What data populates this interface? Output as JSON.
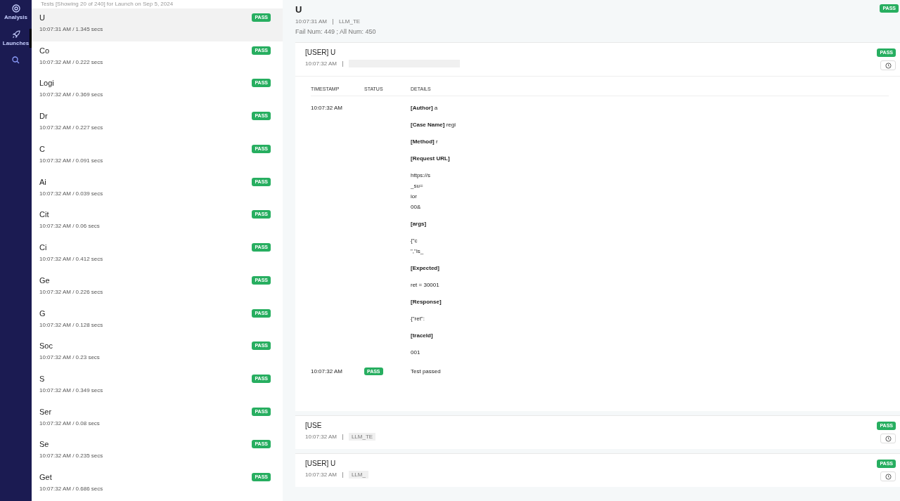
{
  "nav": [
    {
      "label": "Analysis",
      "selected": false
    },
    {
      "label": "Launches",
      "selected": true
    },
    {
      "selected": false
    }
  ],
  "list": {
    "header": "Tests [Showing 20 of 240] for Launch on Sep 5, 2024",
    "items": [
      {
        "name": "U",
        "meta": "10:07:31 AM / 1.345 secs",
        "status": "PASS",
        "selected": true
      },
      {
        "name": "Co",
        "meta": "10:07:32 AM / 0.222 secs",
        "status": "PASS",
        "selected": false
      },
      {
        "name": "Logi",
        "meta": "10:07:32 AM / 0.369 secs",
        "status": "PASS",
        "selected": false
      },
      {
        "name": "Dr",
        "meta": "10:07:32 AM / 0.227 secs",
        "status": "PASS",
        "selected": false
      },
      {
        "name": "C",
        "meta": "10:07:32 AM / 0.091 secs",
        "status": "PASS",
        "selected": false
      },
      {
        "name": "Ai",
        "meta": "10:07:32 AM / 0.039 secs",
        "status": "PASS",
        "selected": false
      },
      {
        "name": "Cit",
        "meta": "10:07:32 AM / 0.06 secs",
        "status": "PASS",
        "selected": false
      },
      {
        "name": "Ci",
        "meta": "10:07:32 AM / 0.412 secs",
        "status": "PASS",
        "selected": false
      },
      {
        "name": "Ge",
        "meta": "10:07:32 AM / 0.226 secs",
        "status": "PASS",
        "selected": false
      },
      {
        "name": "G",
        "meta": "10:07:32 AM / 0.128 secs",
        "status": "PASS",
        "selected": false
      },
      {
        "name": "Soc",
        "meta": "10:07:32 AM / 0.23 secs",
        "status": "PASS",
        "selected": false
      },
      {
        "name": "S",
        "meta": "10:07:32 AM / 0.349 secs",
        "status": "PASS",
        "selected": false
      },
      {
        "name": "Ser",
        "meta": "10:07:32 AM / 0.08 secs",
        "status": "PASS",
        "selected": false
      },
      {
        "name": "Se",
        "meta": "10:07:32 AM / 0.235 secs",
        "status": "PASS",
        "selected": false
      },
      {
        "name": "Get",
        "meta": "10:07:32 AM / 0.686 secs",
        "status": "PASS",
        "selected": false
      }
    ]
  },
  "detail": {
    "title": "U",
    "status": "PASS",
    "time": "10:07:31 AM",
    "id": "LLM_TE",
    "counts": "Fail Num: 449 ; All Num: 450",
    "tests": [
      {
        "title": "[USER] U",
        "time": "10:07:32 AM",
        "status": "PASS",
        "columns": [
          "TIMESTAMP",
          "STATUS",
          "DETAILS"
        ],
        "logs": [
          {
            "time": "10:07:32 AM",
            "lines": [
              {
                "kind": "field",
                "label": "[Author]",
                "text": "a"
              },
              {
                "kind": "field",
                "label": "[Case Name]",
                "text": "regi"
              },
              {
                "kind": "field",
                "label": "[Method]",
                "text": "r"
              },
              {
                "kind": "label",
                "text": "[Request URL]"
              },
              {
                "kind": "text",
                "text": "https://s"
              },
              {
                "kind": "text",
                "text": "_su="
              },
              {
                "kind": "text",
                "text": "ior"
              },
              {
                "kind": "text",
                "text": "00&"
              },
              {
                "kind": "label",
                "text": "[args]"
              },
              {
                "kind": "text",
                "text": "{\"c"
              },
              {
                "kind": "text",
                "text": "\",\"is_"
              },
              {
                "kind": "label",
                "text": "[Expected]"
              },
              {
                "kind": "text",
                "text": "ret = 30001"
              },
              {
                "kind": "label",
                "text": "[Response]"
              },
              {
                "kind": "text",
                "text": "{\"ret\":"
              },
              {
                "kind": "label",
                "text": "[traceId]"
              },
              {
                "kind": "text",
                "text": "001"
              }
            ]
          },
          {
            "time": "10:07:32 AM",
            "status": "PASS",
            "lines": [
              {
                "kind": "text",
                "text": "Test passed"
              }
            ]
          }
        ]
      },
      {
        "title": "[USE",
        "time": "10:07:32 AM",
        "id": "LLM_TE",
        "status": "PASS"
      },
      {
        "title": "[USER] U",
        "time": "10:07:32 AM",
        "id": "LLM_",
        "status": "PASS"
      }
    ]
  }
}
